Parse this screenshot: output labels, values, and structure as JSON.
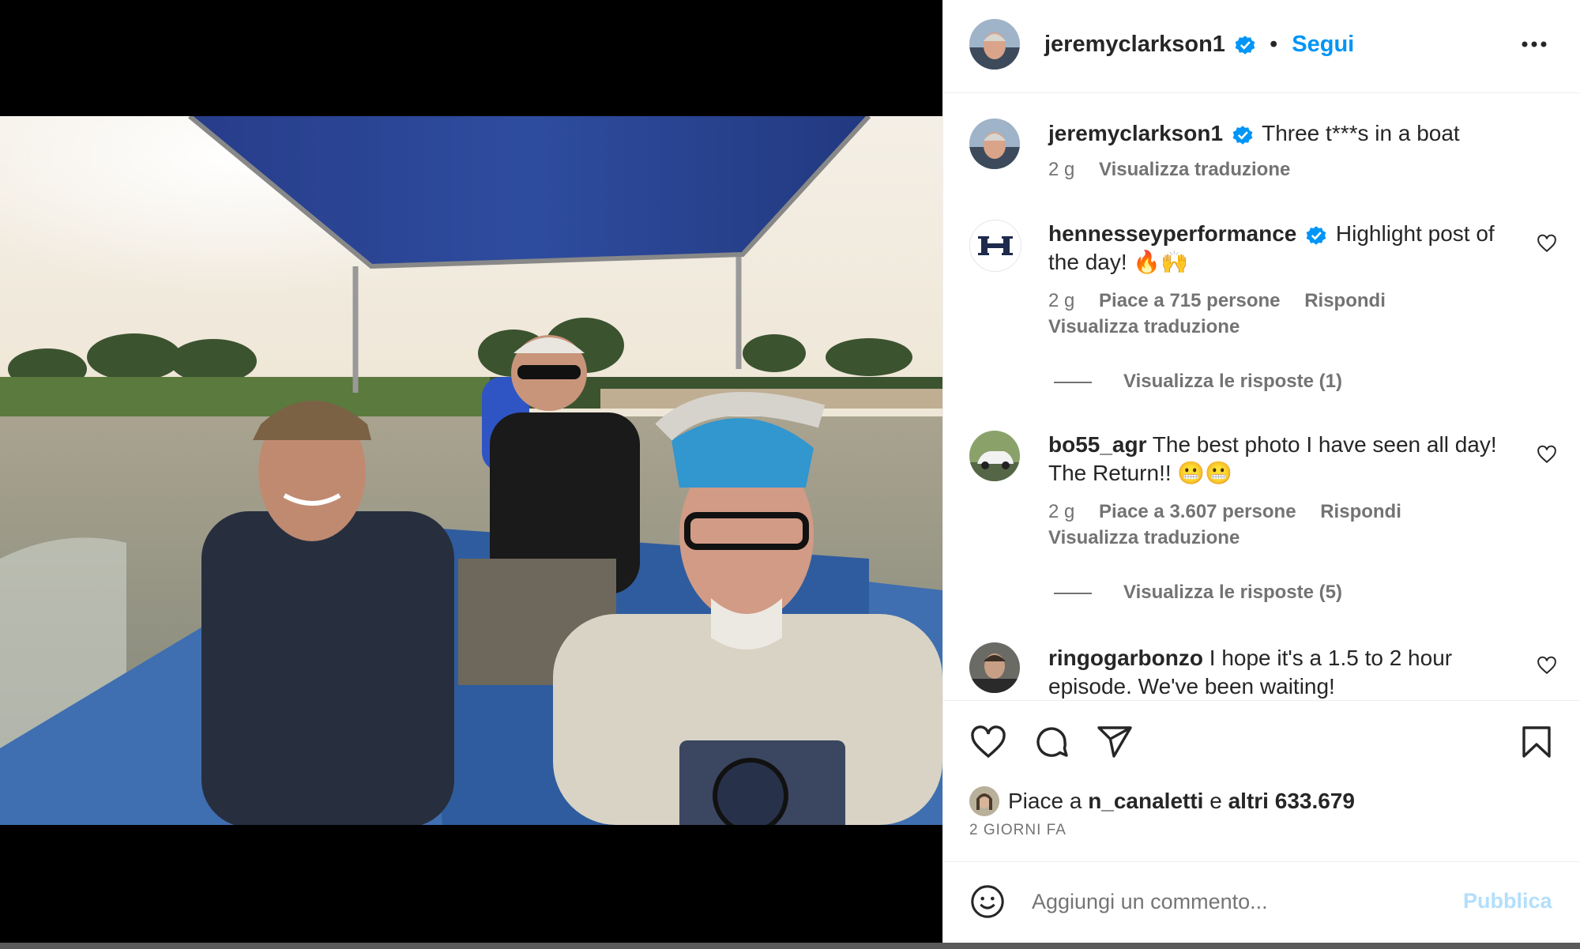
{
  "post": {
    "author": "jeremyclarkson1",
    "follow_label": "Segui",
    "dot": "•",
    "more_label": "•••",
    "caption": "Three t***s in a boat",
    "caption_age": "2 g",
    "translate_label": "Visualizza traduzione"
  },
  "comments": [
    {
      "username": "hennesseyperformance",
      "verified": true,
      "text_line1": "Highlight post of",
      "text_line2": "the day! 🔥🙌",
      "age": "2 g",
      "likes": "Piace a 715 persone",
      "reply_label": "Rispondi",
      "translate_label": "Visualizza traduzione",
      "view_replies": "Visualizza le risposte (1)"
    },
    {
      "username": "bo55_agr",
      "verified": false,
      "text_line1": "The best photo I have seen all day!",
      "text_line2": "The Return!! 😬😬",
      "age": "2 g",
      "likes": "Piace a 3.607 persone",
      "reply_label": "Rispondi",
      "translate_label": "Visualizza traduzione",
      "view_replies": "Visualizza le risposte (5)"
    },
    {
      "username": "ringogarbonzo",
      "verified": false,
      "text_line1": "I hope it's a 1.5 to 2 hour",
      "text_line2": "episode. We've been waiting!"
    }
  ],
  "likes_summary": {
    "prefix": "Piace a",
    "user": "n_canaletti",
    "joiner": "e",
    "others": "altri 633.679"
  },
  "timestamp": "2 GIORNI FA",
  "comment_box": {
    "placeholder": "Aggiungi un commento...",
    "publish_label": "Pubblica"
  },
  "colors": {
    "accent": "#0095f6",
    "accent_disabled": "#b2dffc",
    "muted": "#737373",
    "text": "#262626"
  },
  "icons": [
    "heart-icon",
    "comment-icon",
    "share-icon",
    "bookmark-icon",
    "emoji-icon",
    "verified-icon",
    "more-icon"
  ]
}
